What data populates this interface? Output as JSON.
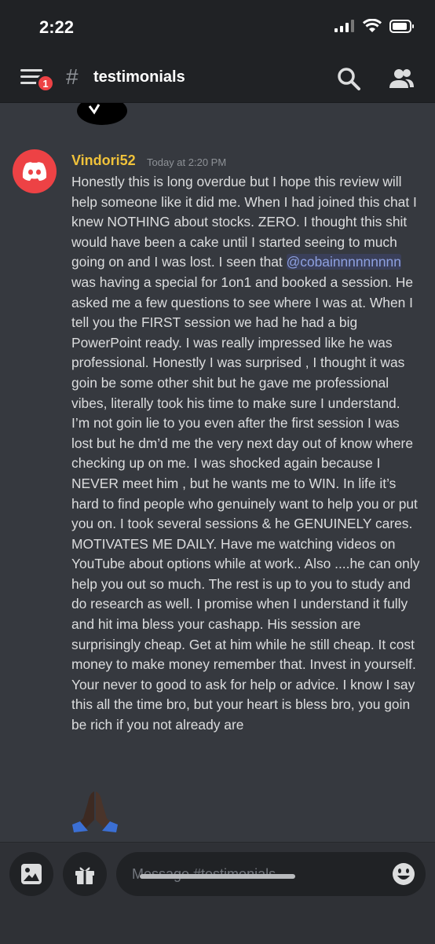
{
  "status_bar": {
    "time": "2:22"
  },
  "header": {
    "badge_count": "1",
    "hash": "#",
    "channel_name": "testimonials"
  },
  "message": {
    "username": "Vindori52",
    "timestamp": "Today at 2:20 PM",
    "text_before_mention": "Honestly this is long overdue but I hope this review will help someone like it did me. When I had joined this chat I knew NOTHING about stocks. ZERO. I thought this shit would have been a cake until I started seeing to much going on and I was lost. I seen that ",
    "mention": "@cobainnnnnnnnn",
    "text_after_mention": " was having a special for 1on1 and booked a session.  He asked me a few questions to see where I was at. When I tell you the FIRST session we had he had a big PowerPoint ready. I was really impressed like he was professional. Honestly I was surprised , I thought it was goin be some other shit but he gave me professional vibes, literally took his time to make sure I understand. I’m not goin lie to you even after the first session I was lost but he dm’d me the very next day out of know where checking up on me. I was shocked again because I NEVER meet him , but he wants me to WIN. In life it’s hard to find people who genuinely want to help you or put you on. I took several sessions & he GENUINELY cares. MOTIVATES ME DAILY. Have me watching videos on YouTube about options while at work.. Also ....he can only help you out so much. The rest is up to you to study and do research as well. I promise when I understand it fully and hit ima bless your cashapp. His session are surprisingly cheap. Get at him while he still cheap. It cost money to make money remember that. Invest in yourself. Your never to good to ask for help or advice. I know I say this all the time bro, but your heart is bless bro, you goin be rich if you not already are"
  },
  "composer": {
    "placeholder": "Message #testimonials"
  },
  "colors": {
    "background": "#36393f",
    "header": "#202225",
    "username": "#f0c23a",
    "mention": "#8ea1e1",
    "badge": "#ed4245"
  },
  "icons": [
    "menu-icon",
    "hash-icon",
    "search-icon",
    "members-icon",
    "discord-avatar-icon",
    "image-icon",
    "gift-icon",
    "emoji-icon",
    "praying-hands-emoji"
  ]
}
